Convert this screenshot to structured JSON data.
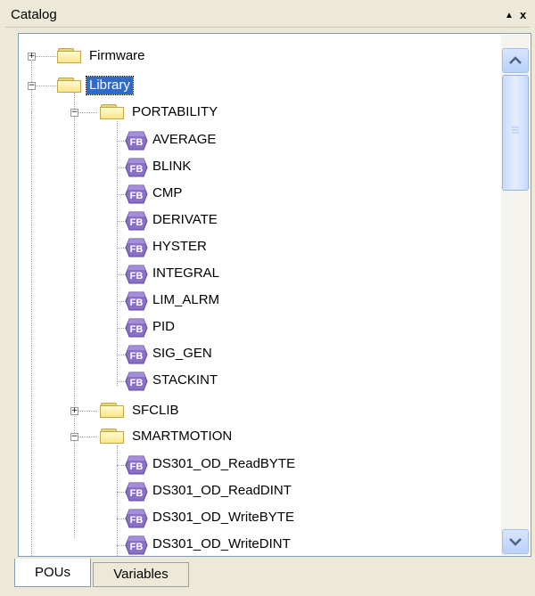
{
  "panel": {
    "title": "Catalog",
    "pin_glyph": "▲",
    "close_glyph": "x"
  },
  "tree": {
    "items": [
      {
        "label": "Firmware",
        "expander": "+"
      },
      {
        "label": "Library",
        "expander": "−",
        "selected": true
      },
      {
        "label": "PORTABILITY",
        "expander": "−"
      },
      {
        "label": "AVERAGE"
      },
      {
        "label": "BLINK"
      },
      {
        "label": "CMP"
      },
      {
        "label": "DERIVATE"
      },
      {
        "label": "HYSTER"
      },
      {
        "label": "INTEGRAL"
      },
      {
        "label": "LIM_ALRM"
      },
      {
        "label": "PID"
      },
      {
        "label": "SIG_GEN"
      },
      {
        "label": "STACKINT"
      },
      {
        "label": "SFCLIB",
        "expander": "+"
      },
      {
        "label": "SMARTMOTION",
        "expander": "−"
      },
      {
        "label": "DS301_OD_ReadBYTE"
      },
      {
        "label": "DS301_OD_ReadDINT"
      },
      {
        "label": "DS301_OD_WriteBYTE"
      },
      {
        "label": "DS301_OD_WriteDINT"
      }
    ],
    "fb_badge": "FB",
    "fb_color": "#8a6fc9"
  },
  "scrollbar": {
    "up_icon": "chevron-up-icon",
    "down_icon": "chevron-down-icon"
  },
  "tabs": [
    {
      "label": "POUs",
      "active": true
    },
    {
      "label": "Variables",
      "active": false
    }
  ]
}
